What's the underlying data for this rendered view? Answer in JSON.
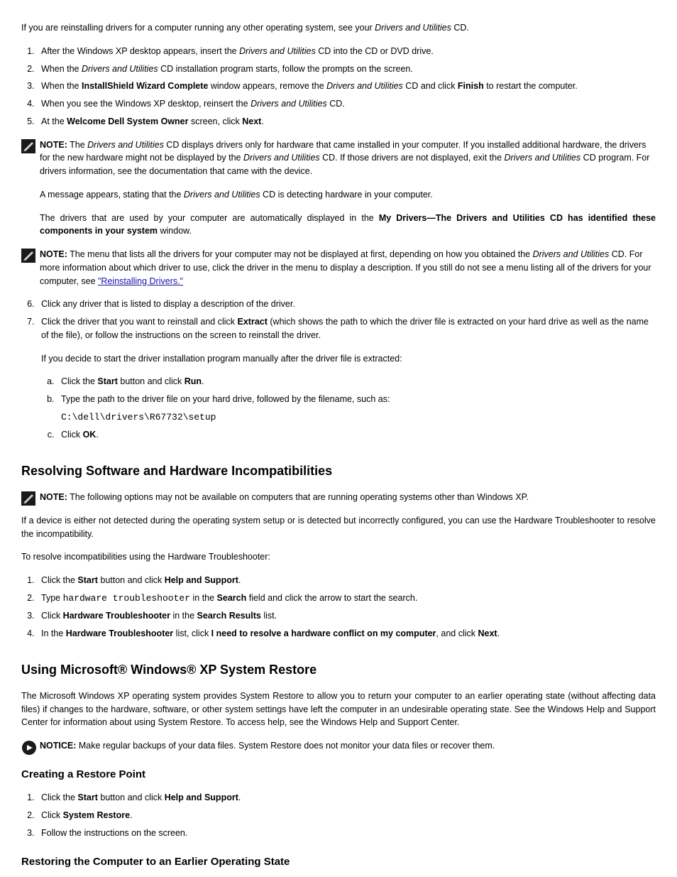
{
  "para1": {
    "pre": "If you are reinstalling drivers for a computer running any other operating system, see your ",
    "product": "Drivers and Utilities",
    "post": " CD."
  },
  "steps_a": [
    {
      "text": "After the Windows XP desktop appears, insert the ",
      "italic": "Drivers and Utilities",
      "post": " CD into the CD or DVD drive."
    },
    {
      "text": "When the ",
      "italic": "Drivers and Utilities",
      "post": " CD installation program starts, follow the prompts on the screen."
    },
    {
      "text": "When the ",
      "bold": "InstallShield Wizard Complete",
      "post": " window appears, remove the ",
      "italic2": "Drivers and Utilities",
      "post2": " CD and click ",
      "bold2": "Finish",
      "post3": " to restart the computer."
    },
    {
      "text": "When you see the Windows XP desktop, reinsert the ",
      "italic": "Drivers and Utilities",
      "post": " CD."
    }
  ],
  "step5": {
    "pre": "At the ",
    "bold": "Welcome Dell System Owner",
    "post": " screen, click ",
    "bold2": "Next",
    "post2": "."
  },
  "note1_label": "NOTE:",
  "note1_text_pre": " The ",
  "note1_italic": "Drivers and Utilities",
  "note1_text_post": " CD displays drivers only for hardware that came installed in your computer. If you installed additional hardware, the drivers for the new hardware might not be displayed by the ",
  "note1_italic2": "Drivers and Utilities",
  "note1_text_post2": " CD. If those drivers are not displayed, exit the ",
  "note1_italic3": "Drivers and Utilities",
  "note1_text_post3": " CD program. For drivers information, see the documentation that came with the device.",
  "msg_para_pre": "A message appears, stating that the ",
  "msg_italic": "Drivers and Utilities",
  "msg_para_post": " CD is detecting hardware in your computer.",
  "msg2_pre": "The drivers that are used by your computer are automatically displayed in the ",
  "msg2_bold": "My Drivers—The Drivers and Utilities CD has identified these components in your system",
  "msg2_post": " window.",
  "note2_label": "NOTE:",
  "note2_text": " The menu that lists all the drivers for your computer may not be displayed at first, depending on how you obtained the ",
  "note2_italic": "Drivers and Utilities",
  "note2_post": " CD. For more information about which driver to use, click the driver in the menu to display a description. If you still do not see a menu listing all of the drivers for your computer, see ",
  "note2_link": "\"Reinstalling Drivers.\"",
  "step6": "Click any driver that is listed to display a description of the driver.",
  "step7": {
    "pre": "Click the driver that you want to reinstall and click ",
    "bold": "Extract",
    "post": " (which shows the path to which the driver file is extracted on your hard drive as well as the name of the file), or follow the instructions on the screen to reinstall the driver."
  },
  "step7_alt": "If you decide to start the driver installation program manually after the driver file is extracted:",
  "sub_a": {
    "pre": "Click the ",
    "bold": "Start",
    "post": " button and click ",
    "bold2": "Run",
    "post2": "."
  },
  "sub_b": "Type the path to the driver file on your hard drive, followed by the filename, such as:",
  "sub_b_path": "C:\\dell\\drivers\\R67732\\setup",
  "sub_c": {
    "pre": "Click ",
    "bold": "OK",
    "post": "."
  },
  "heading_resolve": "Resolving Software and Hardware Incompatibilities",
  "note3_label": "NOTE:",
  "note3_text": " The following options may not be available on computers that are running operating systems other than Windows XP.",
  "resolve_intro": "If a device is either not detected during the operating system setup or is detected but incorrectly configured, you can use the Hardware Troubleshooter to resolve the incompatibility.",
  "resolve_lead": "To resolve incompatibilities using the Hardware Troubleshooter:",
  "resolve_steps": [
    {
      "pre": "Click the ",
      "bold": "Start",
      "post": " button and click ",
      "bold2": "Help and Support",
      "post2": "."
    },
    {
      "pre": "Type ",
      "mono": "hardware troubleshooter",
      "post": " in the ",
      "bold": "Search",
      "post2": " field and click the arrow to start the search."
    },
    {
      "pre": "Click ",
      "bold": "Hardware Troubleshooter",
      "post": " in the ",
      "bold2": "Search Results",
      "post2": " list."
    },
    {
      "pre": "In the ",
      "bold": "Hardware Troubleshooter",
      "post": " list, click ",
      "bold2": "I need to resolve a hardware conflict on my computer",
      "post2": ", and click ",
      "bold3": "Next",
      "post3": "."
    }
  ],
  "heading_restore": "Using Microsoft® Windows® XP System Restore",
  "restore_intro": "The Microsoft Windows XP operating system provides System Restore to allow you to return your computer to an earlier operating state (without affecting data files) if changes to the hardware, software, or other system settings have left the computer in an undesirable operating state. See the Windows Help and Support Center for information about using System Restore. To access help, see the Windows Help and Support Center.",
  "notice_label": "NOTICE:",
  "notice_text": " Make regular backups of your data files. System Restore does not monitor your data files or recover them.",
  "heading_create": "Creating a Restore Point",
  "create_steps_1": {
    "pre": "Click the ",
    "bold": "Start",
    "post": " button and click ",
    "bold2": "Help and Support",
    "post2": "."
  },
  "create_steps_2": {
    "pre": "Click ",
    "bold": "System Restore",
    "post": "."
  },
  "create_steps_3": "Follow the instructions on the screen.",
  "heading_earlier": "Restoring the Computer to an Earlier Operating State"
}
